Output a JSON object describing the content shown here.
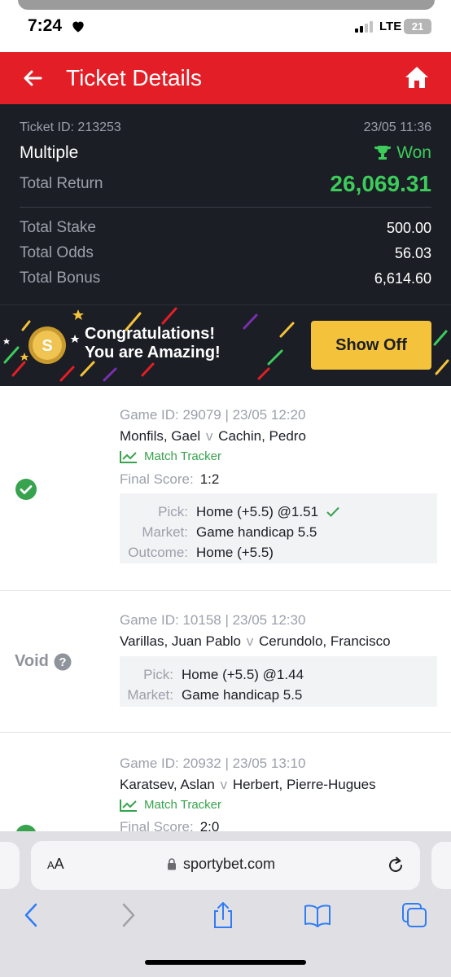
{
  "status_bar": {
    "time": "7:24",
    "network": "LTE",
    "battery": "21"
  },
  "header": {
    "title": "Ticket Details"
  },
  "summary": {
    "ticket_id": "Ticket ID: 213253",
    "datetime": "23/05 11:36",
    "bet_type": "Multiple",
    "status": "Won",
    "total_return_label": "Total Return",
    "total_return": "26,069.31",
    "total_stake_label": "Total Stake",
    "total_stake": "500.00",
    "total_odds_label": "Total Odds",
    "total_odds": "56.03",
    "total_bonus_label": "Total Bonus",
    "total_bonus": "6,614.60"
  },
  "banner": {
    "line1": "Congratulations!",
    "line2": "You are Amazing!",
    "button_label": "Show Off"
  },
  "games": [
    {
      "meta": "Game ID: 29079 | 23/05 12:20",
      "home": "Monfils, Gael",
      "vs": "v",
      "away": "Cachin, Pedro",
      "tracker": "Match Tracker",
      "score_label": "Final Score:",
      "score": "1:2",
      "pick_label": "Pick:",
      "pick": "Home (+5.5) @1.51",
      "market_label": "Market:",
      "market": "Game handicap 5.5",
      "outcome_label": "Outcome:",
      "outcome": "Home (+5.5)"
    },
    {
      "status": "Void",
      "meta": "Game ID: 10158 | 23/05 12:30",
      "home": "Varillas, Juan Pablo",
      "vs": "v",
      "away": "Cerundolo, Francisco",
      "pick_label": "Pick:",
      "pick": "Home (+5.5) @1.44",
      "market_label": "Market:",
      "market": "Game handicap 5.5"
    },
    {
      "meta": "Game ID: 20932 | 23/05 13:10",
      "home": "Karatsev, Aslan",
      "vs": "v",
      "away": "Herbert, Pierre-Hugues",
      "tracker": "Match Tracker",
      "score_label": "Final Score:",
      "score": "2:0"
    }
  ],
  "browser": {
    "aa_large": "A",
    "aa_small": "A",
    "url": "sportybet.com"
  },
  "colors": {
    "brand_red": "#e41e26",
    "won_green": "#3dcb5b",
    "show_off_yellow": "#f5c33b",
    "dark_panel": "#1b1e25"
  }
}
